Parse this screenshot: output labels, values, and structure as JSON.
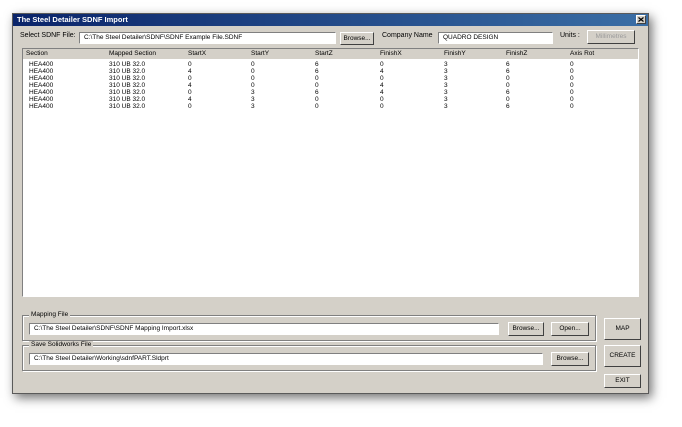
{
  "window": {
    "title": "The Steel Detailer SDNF Import"
  },
  "icons": {
    "close": "close-icon"
  },
  "top": {
    "sdnf_label": "Select SDNF File:",
    "sdnf_value": "C:\\The Steel Detailer\\SDNF\\SDNF Example File.SDNF",
    "browse_label": "Browse...",
    "company_label": "Company Name",
    "company_value": "QUADRO DESIGN",
    "units_label": "Units :",
    "units_value": "Millimetres"
  },
  "table": {
    "columns": [
      "Section",
      "Mapped Section",
      "StartX",
      "StartY",
      "StartZ",
      "FinishX",
      "FinishY",
      "FinishZ",
      "Axis Rot"
    ],
    "rows": [
      [
        "HEA400",
        "310 UB 32.0",
        "0",
        "0",
        "6",
        "0",
        "3",
        "6",
        "0"
      ],
      [
        "HEA400",
        "310 UB 32.0",
        "4",
        "0",
        "6",
        "4",
        "3",
        "6",
        "0"
      ],
      [
        "HEA400",
        "310 UB 32.0",
        "0",
        "0",
        "0",
        "0",
        "3",
        "0",
        "0"
      ],
      [
        "HEA400",
        "310 UB 32.0",
        "4",
        "0",
        "0",
        "4",
        "3",
        "0",
        "0"
      ],
      [
        "HEA400",
        "310 UB 32.0",
        "0",
        "3",
        "6",
        "4",
        "3",
        "6",
        "0"
      ],
      [
        "HEA400",
        "310 UB 32.0",
        "4",
        "3",
        "0",
        "0",
        "3",
        "0",
        "0"
      ],
      [
        "HEA400",
        "310 UB 32.0",
        "0",
        "3",
        "0",
        "0",
        "3",
        "6",
        "0"
      ]
    ]
  },
  "mapping": {
    "legend": "Mapping File",
    "value": "C:\\The Steel Detailer\\SDNF\\SDNF Mapping Import.xlsx",
    "browse_label": "Browse...",
    "open_label": "Open..."
  },
  "save": {
    "legend": "Save Solidworks File",
    "value": "C:\\The Steel Detailer\\Working\\sdnfPART.Sldprt",
    "browse_label": "Browse..."
  },
  "actions": {
    "map": "MAP",
    "create": "CREATE",
    "exit": "EXIT"
  }
}
